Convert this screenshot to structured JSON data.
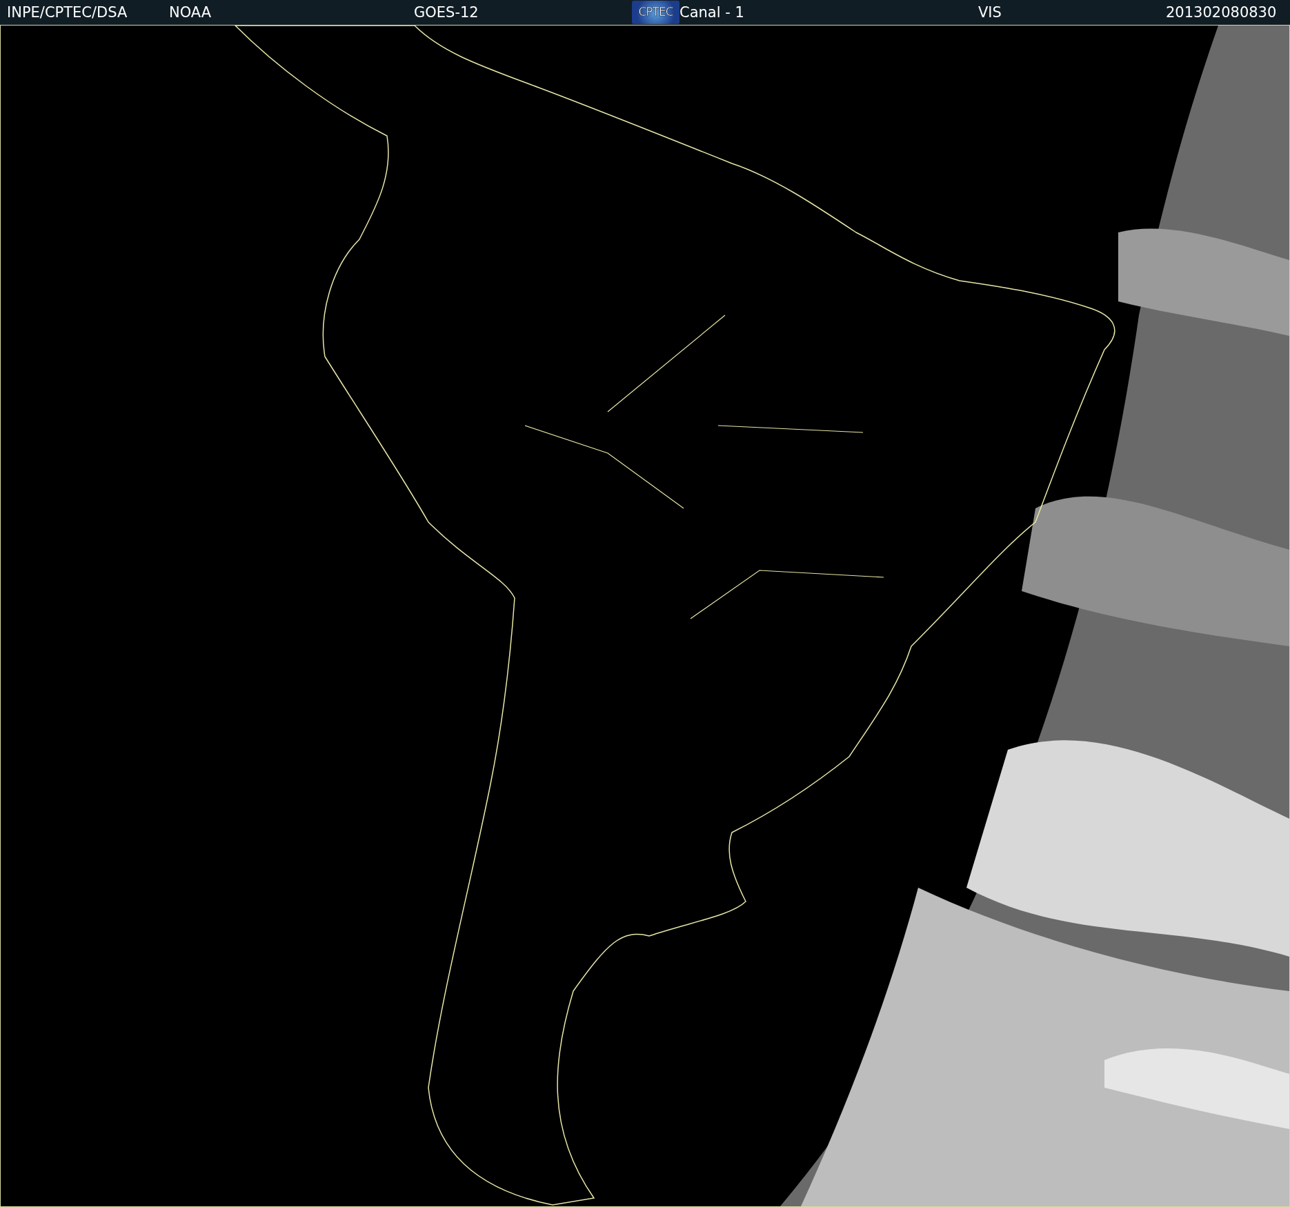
{
  "header": {
    "items": [
      {
        "kind": "text",
        "text": "INPE/CPTEC/DSA"
      },
      {
        "kind": "text",
        "text": "NOAA"
      },
      {
        "kind": "text",
        "text": "GOES-12"
      },
      {
        "kind": "logo",
        "text": "CPTEC"
      },
      {
        "kind": "text",
        "text": "Canal - 1"
      },
      {
        "kind": "text",
        "text": "VIS"
      },
      {
        "kind": "text",
        "text": "201302080830"
      }
    ]
  }
}
